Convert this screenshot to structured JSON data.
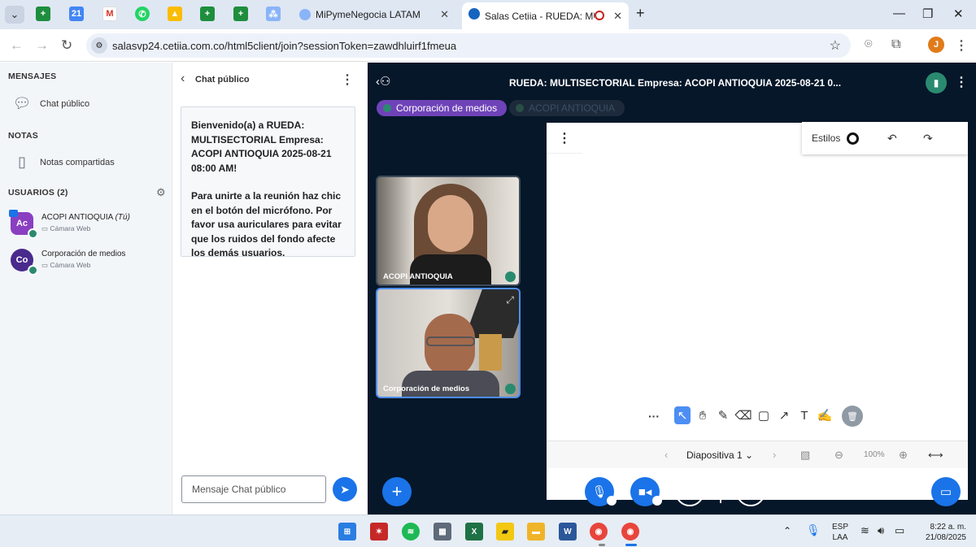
{
  "browser": {
    "tabs": [
      {
        "title": "MiPymeNegocia LATAM"
      },
      {
        "title": "Salas Cetiia - RUEDA: MULTI"
      }
    ],
    "url": "salasvp24.cetiia.com.co/html5client/join?sessionToken=zawdhluirf1fmeua",
    "profile_initial": "J"
  },
  "sidebar": {
    "messages_heading": "MENSAJES",
    "public_chat": "Chat público",
    "notes_heading": "NOTAS",
    "shared_notes": "Notas compartidas",
    "users_heading": "USUARIOS (2)",
    "users": [
      {
        "initials": "Ac",
        "name": "ACOPI ANTIOQUIA",
        "you": "(Tú)",
        "sub": "Cámara Web",
        "color": "#8a3fc1"
      },
      {
        "initials": "Co",
        "name": "Corporación de medios",
        "you": "",
        "sub": "Cámara Web",
        "color": "#4a2a8c"
      }
    ]
  },
  "chat": {
    "title": "Chat público",
    "welcome_line1": "Bienvenido(a) a RUEDA: MULTISECTORIAL Empresa: ACOPI ANTIOQUIA 2025-08-21 08:00 AM!",
    "welcome_line2": "Para unirte a la reunión haz chic en el botón del micrófono. Por favor usa auriculares para evitar que los ruidos del fondo afecte los demás usuarios.",
    "input_placeholder": "Mensaje Chat público"
  },
  "meeting": {
    "title": "RUEDA: MULTISECTORIAL Empresa: ACOPI ANTIOQUIA 2025-08-21 0...",
    "talkers": [
      {
        "name": "Corporación de medios",
        "active": true
      },
      {
        "name": "ACOPI ANTIOQUIA",
        "active": false
      }
    ],
    "videos": [
      {
        "name": "ACOPI ANTIOQUIA"
      },
      {
        "name": "Corporación de medios"
      }
    ],
    "styles_label": "Estilos",
    "slide_label": "Diapositiva 1",
    "zoom": "100%"
  },
  "taskbar": {
    "lang_line1": "ESP",
    "lang_line2": "LAA",
    "time": "8:22 a. m.",
    "date": "21/08/2025"
  }
}
